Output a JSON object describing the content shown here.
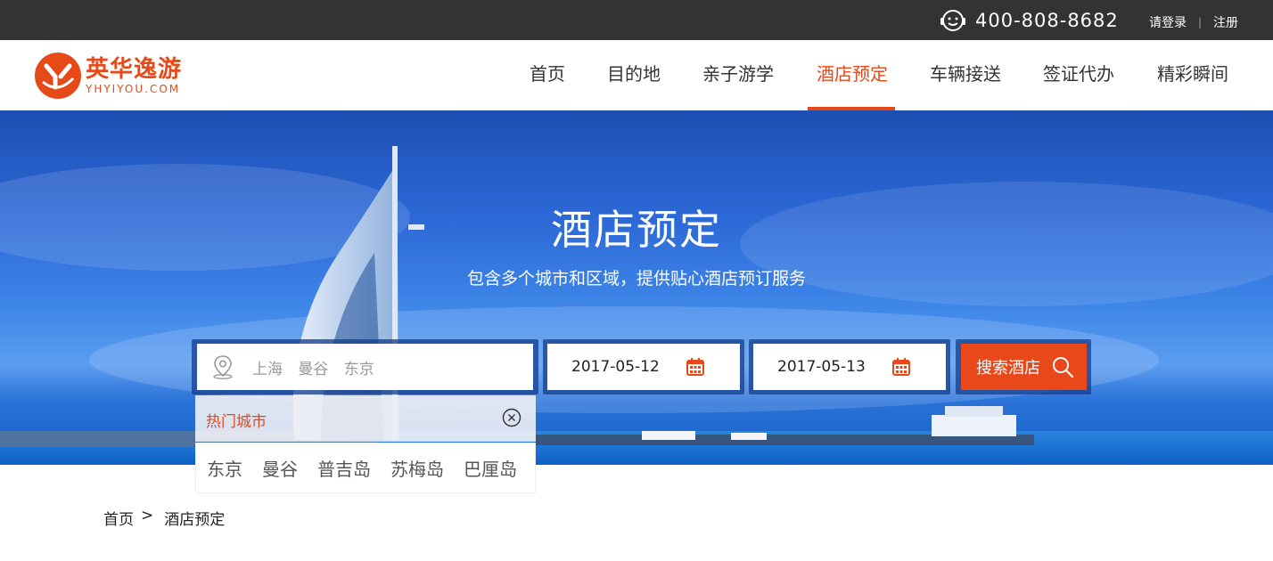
{
  "topbar": {
    "phone_icon": "headset-smiley-icon",
    "phone_number": "400-808-8682",
    "login": "请登录",
    "separator": "|",
    "register": "注册"
  },
  "logo": {
    "name_cn": "英华逸游",
    "name_en": "YHYIYOU.COM",
    "brand_color": "#e64a19"
  },
  "nav": {
    "items": [
      {
        "label": "首页",
        "active": false
      },
      {
        "label": "目的地",
        "active": false
      },
      {
        "label": "亲子游学",
        "active": false
      },
      {
        "label": "酒店预定",
        "active": true
      },
      {
        "label": "车辆接送",
        "active": false
      },
      {
        "label": "签证代办",
        "active": false
      },
      {
        "label": "精彩瞬间",
        "active": false
      }
    ],
    "active_color": "#e64a19"
  },
  "hero": {
    "title": "酒店预定",
    "subtitle": "包含多个城市和区域，提供贴心酒店预订服务"
  },
  "search": {
    "city_placeholder": "上海 曼谷 东京",
    "checkin": "2017-05-12",
    "checkout": "2017-05-13",
    "button_label": "搜索酒店",
    "pin_icon": "location-pin-icon",
    "calendar_icon": "calendar-icon",
    "search_icon": "magnifier-icon"
  },
  "hot_cities": {
    "title": "热门城市",
    "close_icon": "close-circle-icon",
    "cities": [
      "东京",
      "曼谷",
      "普吉岛",
      "苏梅岛",
      "巴厘岛"
    ]
  },
  "breadcrumb": {
    "home": "首页",
    "separator": ">",
    "current": "酒店预定"
  }
}
